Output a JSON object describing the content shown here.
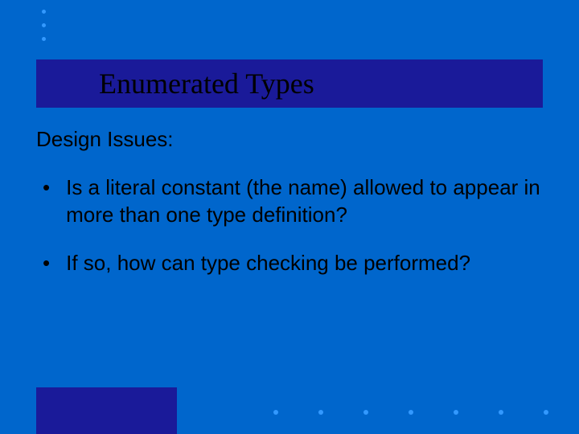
{
  "slide": {
    "title": "Enumerated Types",
    "subheading": "Design Issues:",
    "bullets": [
      "Is a literal constant (the name) allowed to appear in more than one type definition?",
      "If so, how can type checking be performed?"
    ]
  },
  "decorations": {
    "top_dots_count": 3,
    "bottom_dots_count": 7
  },
  "colors": {
    "background": "#0066cc",
    "title_bar": "#1a1a99",
    "dot": "#3399ff",
    "text": "#000000"
  }
}
